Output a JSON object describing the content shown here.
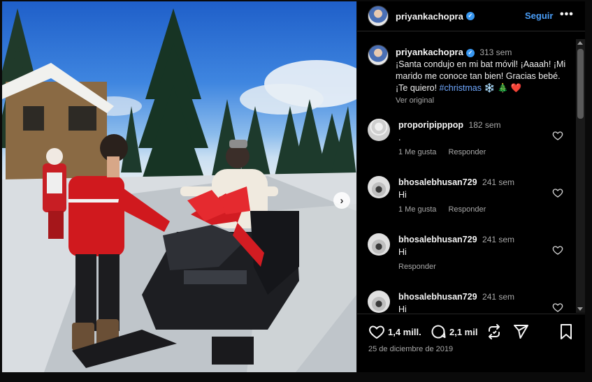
{
  "post": {
    "username": "priyankachopra",
    "follow_label": "Seguir",
    "more_label": "•••",
    "next_label": "›"
  },
  "caption": {
    "username": "priyankachopra",
    "time": "313 sem",
    "text": "¡Santa condujo en mi bat móvil! ¡Aaaah! ¡Mi marido me conoce tan bien! Gracias bebé. ¡Te quiero!",
    "hashtag": "#christmas",
    "emojis": "❄️ 🎄 ❤️",
    "see_original": "Ver original"
  },
  "comments": [
    {
      "username": "proporipipppop",
      "time": "182 sem",
      "text": ".",
      "likes": "1 Me gusta",
      "reply": "Responder",
      "avatar": "default-avatar"
    },
    {
      "username": "bhosalebhusan729",
      "time": "241 sem",
      "text": "Hi",
      "likes": "1 Me gusta",
      "reply": "Responder",
      "avatar": "car-avatar"
    },
    {
      "username": "bhosalebhusan729",
      "time": "241 sem",
      "text": "Hi",
      "likes": "",
      "reply": "Responder",
      "avatar": "car-avatar"
    },
    {
      "username": "bhosalebhusan729",
      "time": "241 sem",
      "text": "Hi",
      "likes": "",
      "reply": "",
      "avatar": "car-avatar"
    }
  ],
  "actions": {
    "likes": "1,4 mill.",
    "comments": "2,1 mil",
    "date": "25 de diciembre de 2019"
  },
  "icons": [
    "verified-badge",
    "heart-icon",
    "comment-icon",
    "repost-icon",
    "share-icon",
    "bookmark-icon",
    "next-arrow-icon"
  ],
  "colors": {
    "accent": "#4a9ef8",
    "background": "#000000",
    "verified": "#3897f0",
    "heart": "#e0245e"
  }
}
